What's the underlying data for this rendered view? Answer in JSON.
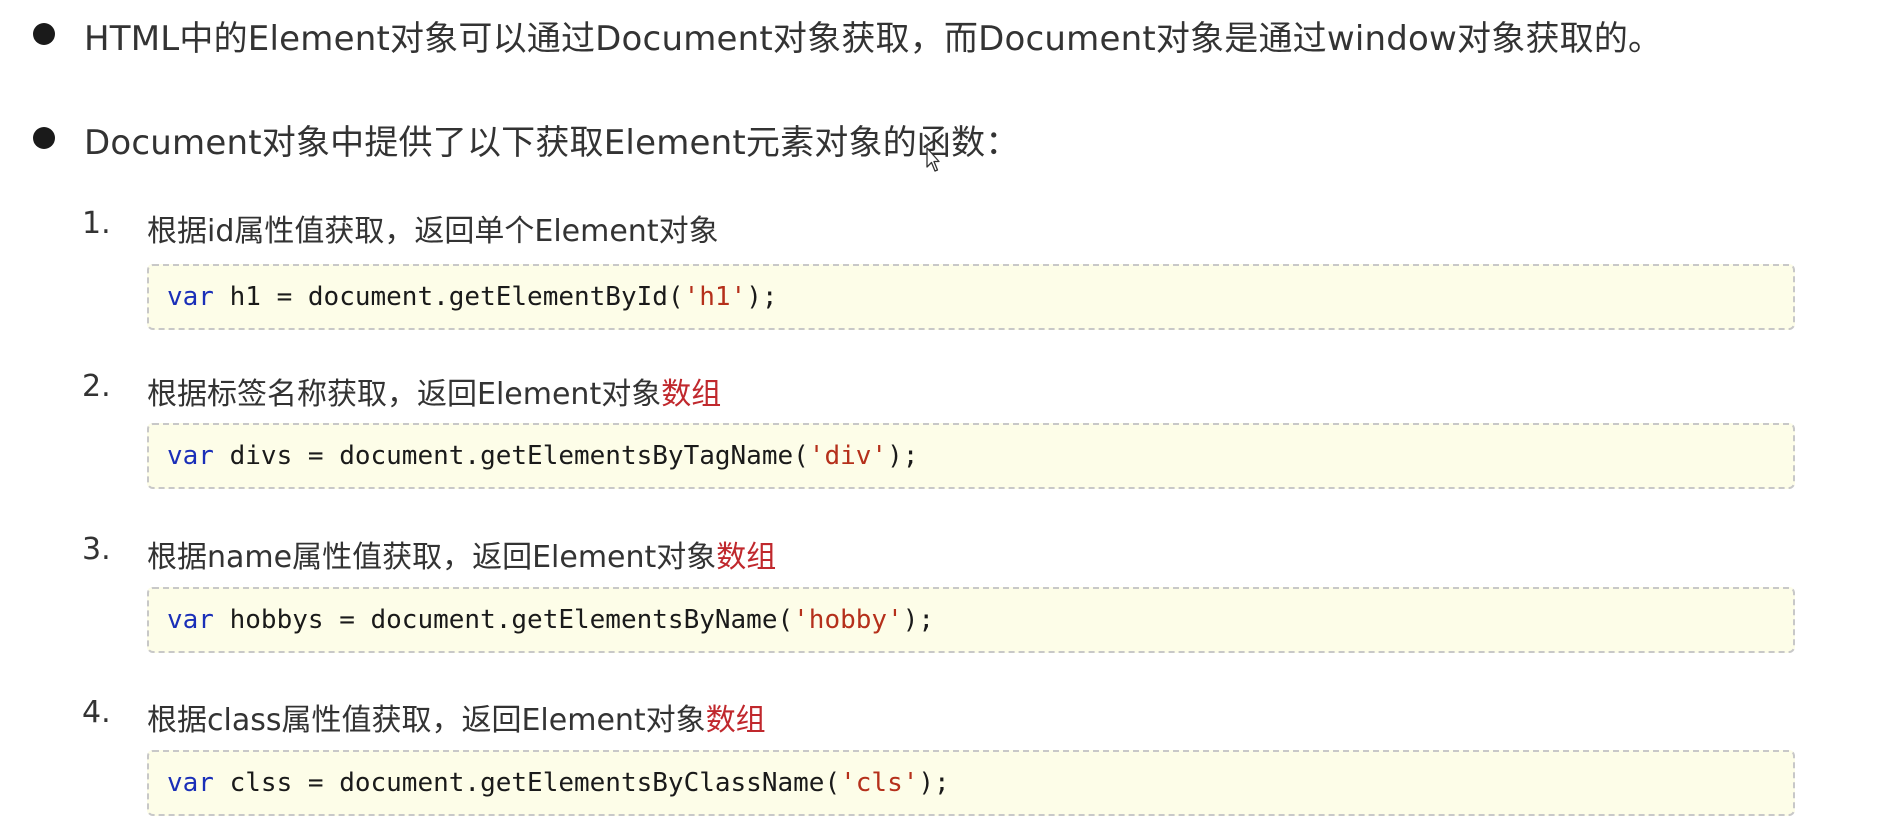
{
  "bullets": [
    {
      "text": "HTML中的Element对象可以通过Document对象获取，而Document对象是通过window对象获取的。"
    },
    {
      "text": "Document对象中提供了以下获取Element元素对象的函数："
    }
  ],
  "items": [
    {
      "num": "1.",
      "label_plain": "根据id属性值获取，返回单个Element对象",
      "label_emph": "",
      "code": {
        "kw": "var",
        "pre": " h1 = document.getElementById(",
        "str": "'h1'",
        "post": ");"
      }
    },
    {
      "num": "2.",
      "label_plain": "根据标签名称获取，返回Element对象",
      "label_emph": "数组",
      "code": {
        "kw": "var",
        "pre": " divs = document.getElementsByTagName(",
        "str": "'div'",
        "post": ");"
      }
    },
    {
      "num": "3.",
      "label_plain": "根据name属性值获取，返回Element对象",
      "label_emph": "数组",
      "code": {
        "kw": "var",
        "pre": " hobbys = document.getElementsByName(",
        "str": "'hobby'",
        "post": ");"
      }
    },
    {
      "num": "4.",
      "label_plain": "根据class属性值获取，返回Element对象",
      "label_emph": "数组",
      "code": {
        "kw": "var",
        "pre": " clss = document.getElementsByClassName(",
        "str": "'cls'",
        "post": ");"
      }
    }
  ],
  "colors": {
    "emphasis": "#c0282d",
    "keyword": "#1a2fb8",
    "string": "#b5301b",
    "code_bg": "#fdfde8"
  },
  "icons": {
    "cursor": "mouse-pointer-icon"
  }
}
